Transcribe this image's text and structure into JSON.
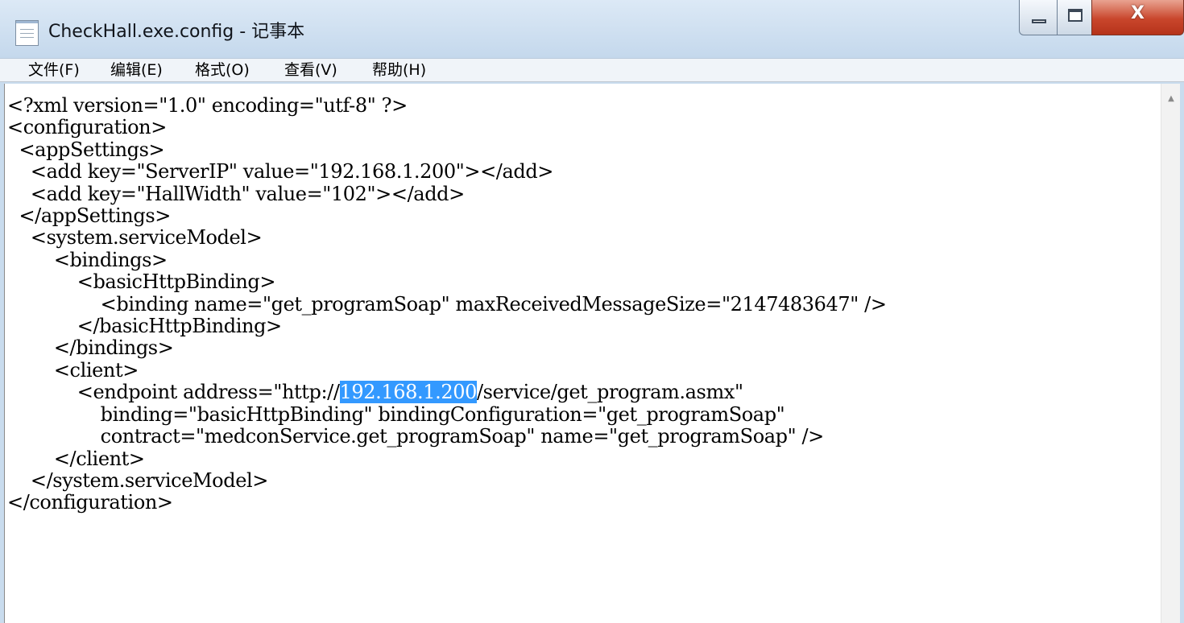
{
  "window": {
    "title": "CheckHall.exe.config - 记事本",
    "icon": "notepad-icon",
    "close_glyph": "X"
  },
  "menu": [
    {
      "label": "文件(F)",
      "name": "file"
    },
    {
      "label": "编辑(E)",
      "name": "edit"
    },
    {
      "label": "格式(O)",
      "name": "format"
    },
    {
      "label": "查看(V)",
      "name": "view"
    },
    {
      "label": "帮助(H)",
      "name": "help"
    }
  ],
  "editor": {
    "lines": [
      "<?xml version=\"1.0\" encoding=\"utf-8\" ?>",
      "<configuration>",
      "  <appSettings>",
      "    <add key=\"ServerIP\" value=\"192.168.1.200\"></add>",
      "    <add key=\"HallWidth\" value=\"102\"></add>",
      "  </appSettings>",
      "    <system.serviceModel>",
      "        <bindings>",
      "            <basicHttpBinding>",
      "                <binding name=\"get_programSoap\" maxReceivedMessageSize=\"2147483647\" />",
      "            </basicHttpBinding>",
      "        </bindings>",
      "        <client>",
      "            <endpoint address=\"http://192.168.1.200/service/get_program.asmx\"",
      "                binding=\"basicHttpBinding\" bindingConfiguration=\"get_programSoap\"",
      "                contract=\"medconService.get_programSoap\" name=\"get_programSoap\" />",
      "        </client>",
      "    </system.serviceModel>",
      "</configuration>"
    ],
    "selection": {
      "line": 13,
      "text": "192.168.1.200"
    }
  },
  "colors": {
    "selection_bg": "#3399ff",
    "selection_fg": "#ffffff",
    "titlebar": "#c9dcee",
    "close_button": "#c9462c"
  }
}
